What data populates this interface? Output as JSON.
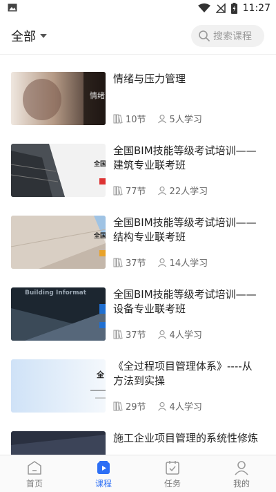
{
  "status_bar": {
    "time": "11:27",
    "icons": [
      "image-icon",
      "wifi-icon",
      "signal-icon",
      "battery-charging-icon"
    ]
  },
  "header": {
    "filter_label": "全部",
    "search_placeholder": "搜索课程"
  },
  "courses": [
    {
      "title": "情绪与压力管理",
      "lessons": "10节",
      "learners": "5人学习",
      "thumb_text": "情绪"
    },
    {
      "title": "全国BIM技能等级考试培训——建筑专业联考班",
      "lessons": "77节",
      "learners": "22人学习",
      "thumb_text": "全国"
    },
    {
      "title": "全国BIM技能等级考试培训——结构专业联考班",
      "lessons": "37节",
      "learners": "14人学习",
      "thumb_text": "全国"
    },
    {
      "title": "全国BIM技能等级考试培训——设备专业联考班",
      "lessons": "37节",
      "learners": "4人学习",
      "thumb_text": "Building Informat"
    },
    {
      "title": "《全过程项目管理体系》----从方法到实操",
      "lessons": "29节",
      "learners": "4人学习",
      "thumb_text": "全"
    },
    {
      "title": "施工企业项目管理的系统性修炼",
      "lessons": "",
      "learners": "",
      "thumb_text": ""
    }
  ],
  "bottom_nav": {
    "tabs": [
      {
        "label": "首页",
        "icon": "home-icon",
        "active": false
      },
      {
        "label": "课程",
        "icon": "course-play-icon",
        "active": true
      },
      {
        "label": "任务",
        "icon": "task-calendar-icon",
        "active": false
      },
      {
        "label": "我的",
        "icon": "profile-icon",
        "active": false
      }
    ]
  },
  "colors": {
    "accent": "#2d6ff5",
    "text_primary": "#222222",
    "text_secondary": "#666666",
    "search_bg": "#f1f1f1"
  }
}
